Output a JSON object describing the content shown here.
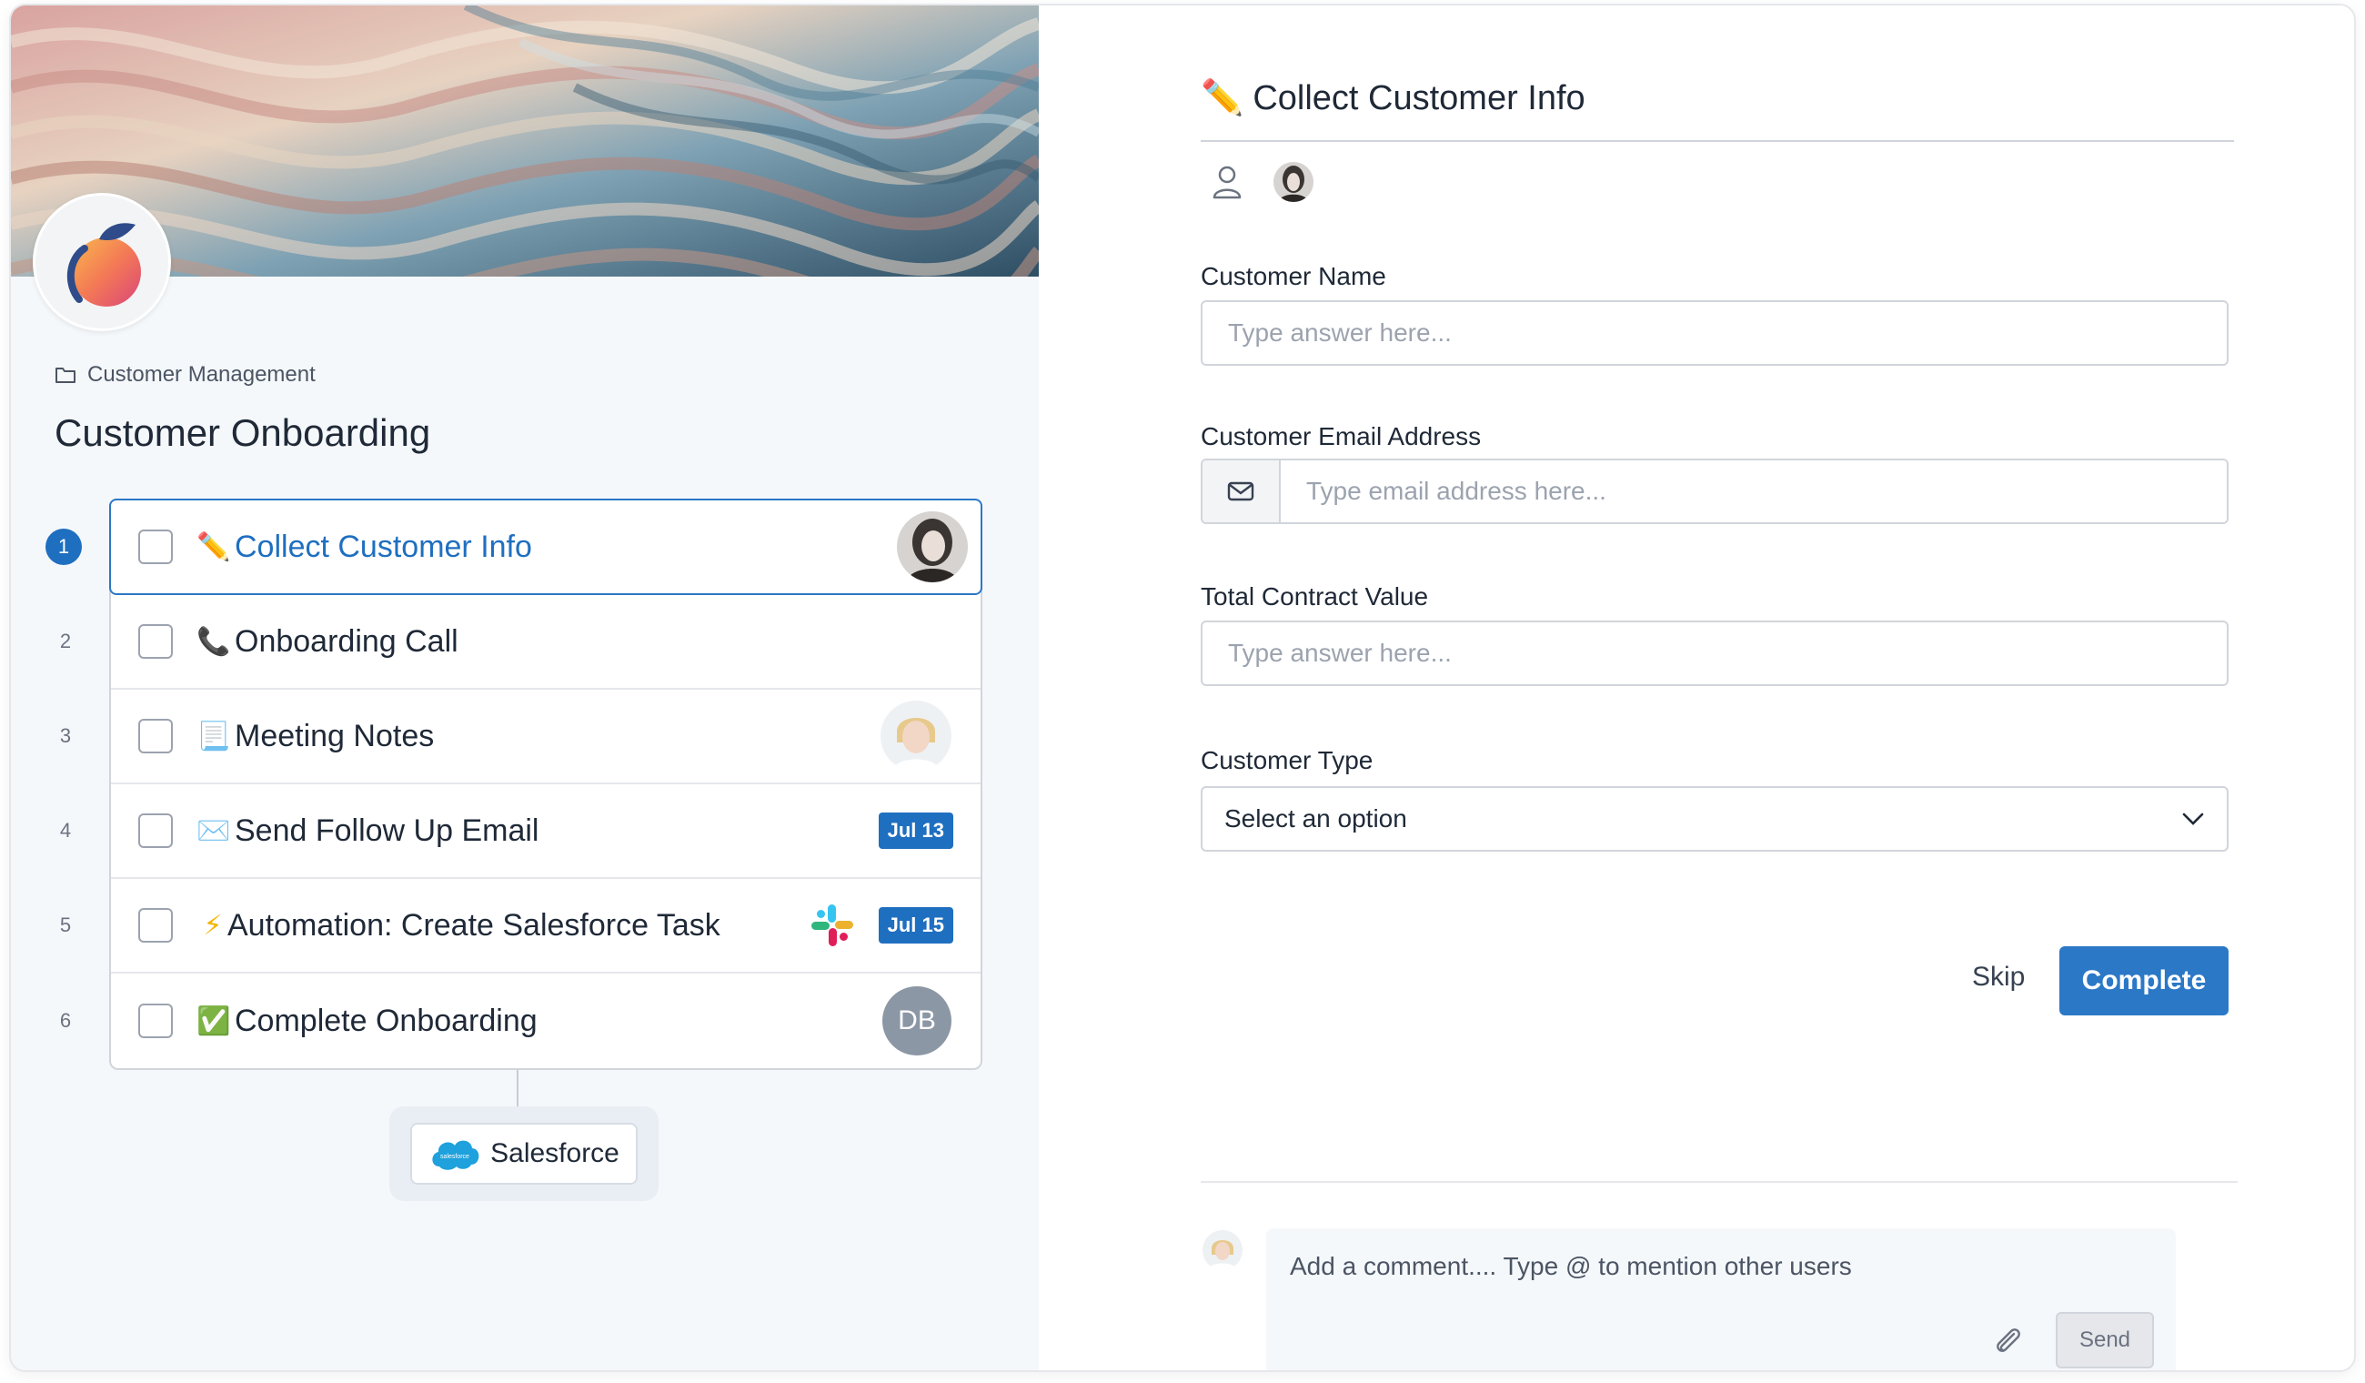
{
  "breadcrumb": {
    "folder": "Customer Management"
  },
  "workflow": {
    "title": "Customer Onboarding"
  },
  "tasks": [
    {
      "num": "1",
      "icon": "✏️",
      "label": "Collect Customer Info"
    },
    {
      "num": "2",
      "icon": "📞",
      "label": "Onboarding Call"
    },
    {
      "num": "3",
      "icon": "📃",
      "label": "Meeting Notes"
    },
    {
      "num": "4",
      "icon": "✉️",
      "label": "Send Follow Up Email",
      "date": "Jul 13"
    },
    {
      "num": "5",
      "icon": "⚡",
      "label": "Automation: Create Salesforce Task",
      "date": "Jul 15"
    },
    {
      "num": "6",
      "icon": "✅",
      "label": "Complete Onboarding",
      "initials": "DB"
    }
  ],
  "integration": {
    "name": "Salesforce",
    "logo_text": "salesforce"
  },
  "form": {
    "icon": "✏️",
    "title": "Collect Customer Info",
    "fields": {
      "name_label": "Customer Name",
      "name_placeholder": "Type answer here...",
      "email_label": "Customer Email Address",
      "email_placeholder": "Type email address here...",
      "contract_label": "Total Contract Value",
      "contract_placeholder": "Type answer here...",
      "type_label": "Customer Type",
      "type_value": "Select an option"
    },
    "skip_label": "Skip",
    "complete_label": "Complete"
  },
  "comment": {
    "placeholder": "Add a comment.... Type @ to mention other users",
    "send_label": "Send"
  },
  "colors": {
    "accent": "#2b78c6",
    "active_text": "#1f6fc0",
    "badge": "#1f6fc0",
    "initials_bg": "#8c97a5"
  }
}
